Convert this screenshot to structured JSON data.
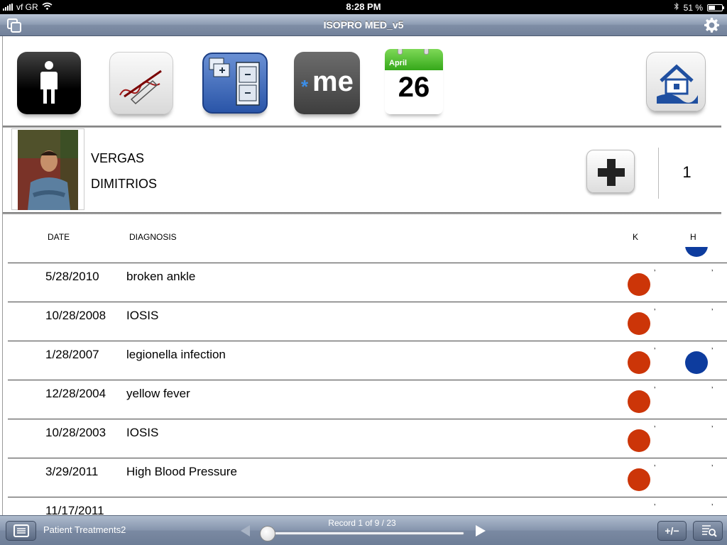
{
  "status_bar": {
    "carrier": "vf GR",
    "time": "8:28 PM",
    "battery": "51 %",
    "battery_level": 0.51,
    "icons": [
      "signal-icon",
      "wifi-icon",
      "bluetooth-icon",
      "battery-icon"
    ]
  },
  "nav": {
    "title": "ISOPRO MED_v5",
    "left_icon": "windows-icon",
    "right_icon": "gear-icon"
  },
  "toolbar_icons": [
    "person-icon",
    "signature-icon",
    "file-cabinet-icon",
    "me-icon",
    "calendar-icon",
    "home-icon"
  ],
  "toolbar_text": {
    "me": "me",
    "calendar_month": "April",
    "calendar_day": "26"
  },
  "patient": {
    "surname": "VERGAS",
    "first_name": "DIMITRIOS",
    "count": "1"
  },
  "table": {
    "headers": {
      "date": "DATE",
      "diagnosis": "DIAGNOSIS",
      "k": "K",
      "h": "H"
    },
    "rows": [
      {
        "date": "5/28/2010",
        "diagnosis": "broken ankle",
        "k": true,
        "h": false
      },
      {
        "date": "10/28/2008",
        "diagnosis": "IOSIS",
        "k": true,
        "h": false
      },
      {
        "date": "1/28/2007",
        "diagnosis": "legionella infection",
        "k": true,
        "h": true
      },
      {
        "date": "12/28/2004",
        "diagnosis": "yellow fever",
        "k": true,
        "h": false
      },
      {
        "date": "10/28/2003",
        "diagnosis": "IOSIS",
        "k": true,
        "h": false
      },
      {
        "date": "3/29/2011",
        "diagnosis": "High Blood Pressure",
        "k": true,
        "h": false
      },
      {
        "date": "11/17/2011",
        "diagnosis": "",
        "k": false,
        "h": false
      }
    ]
  },
  "colors": {
    "k_dot": "#cc3508",
    "h_dot": "#0d3c9e"
  },
  "bottom_bar": {
    "layout_name": "Patient Treatments2",
    "record_text": "Record 1 of 9 / 23",
    "add_label": "+/−",
    "slider_position": 0
  }
}
